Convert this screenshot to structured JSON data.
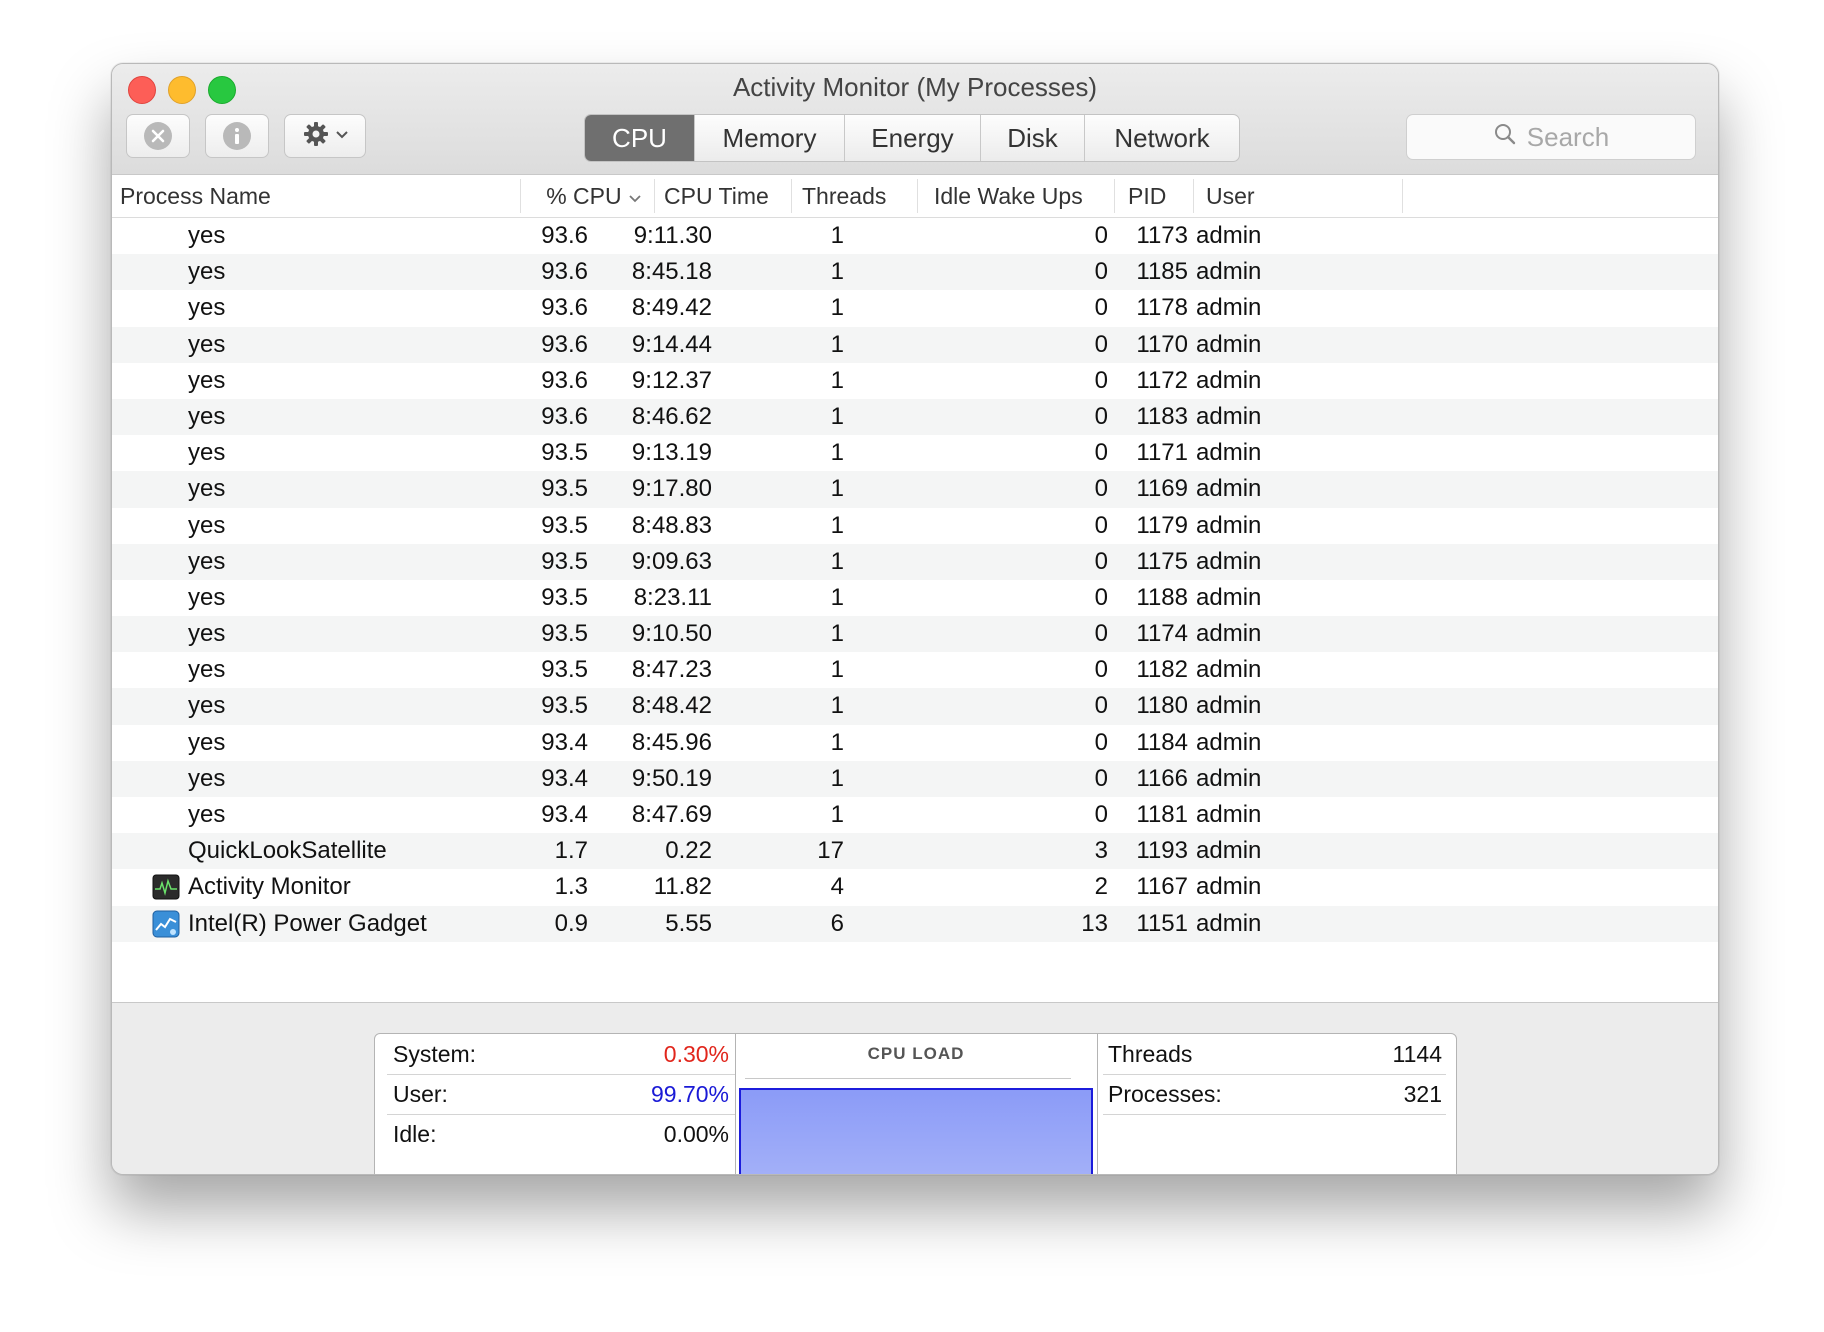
{
  "window": {
    "title": "Activity Monitor (My Processes)"
  },
  "toolbar": {
    "tabs": [
      {
        "label": "CPU",
        "active": true
      },
      {
        "label": "Memory",
        "active": false
      },
      {
        "label": "Energy",
        "active": false
      },
      {
        "label": "Disk",
        "active": false
      },
      {
        "label": "Network",
        "active": false
      }
    ],
    "search_placeholder": "Search"
  },
  "table": {
    "columns": {
      "process_name": "Process Name",
      "cpu_percent": "% CPU",
      "cpu_time": "CPU Time",
      "threads": "Threads",
      "idle_wake_ups": "Idle Wake Ups",
      "pid": "PID",
      "user": "User"
    },
    "sort_column": "cpu_percent",
    "rows": [
      {
        "name": "yes",
        "cpu": "93.6",
        "time": "9:11.30",
        "threads": "1",
        "idle": "0",
        "pid": "1173",
        "user": "admin",
        "icon": ""
      },
      {
        "name": "yes",
        "cpu": "93.6",
        "time": "8:45.18",
        "threads": "1",
        "idle": "0",
        "pid": "1185",
        "user": "admin",
        "icon": ""
      },
      {
        "name": "yes",
        "cpu": "93.6",
        "time": "8:49.42",
        "threads": "1",
        "idle": "0",
        "pid": "1178",
        "user": "admin",
        "icon": ""
      },
      {
        "name": "yes",
        "cpu": "93.6",
        "time": "9:14.44",
        "threads": "1",
        "idle": "0",
        "pid": "1170",
        "user": "admin",
        "icon": ""
      },
      {
        "name": "yes",
        "cpu": "93.6",
        "time": "9:12.37",
        "threads": "1",
        "idle": "0",
        "pid": "1172",
        "user": "admin",
        "icon": ""
      },
      {
        "name": "yes",
        "cpu": "93.6",
        "time": "8:46.62",
        "threads": "1",
        "idle": "0",
        "pid": "1183",
        "user": "admin",
        "icon": ""
      },
      {
        "name": "yes",
        "cpu": "93.5",
        "time": "9:13.19",
        "threads": "1",
        "idle": "0",
        "pid": "1171",
        "user": "admin",
        "icon": ""
      },
      {
        "name": "yes",
        "cpu": "93.5",
        "time": "9:17.80",
        "threads": "1",
        "idle": "0",
        "pid": "1169",
        "user": "admin",
        "icon": ""
      },
      {
        "name": "yes",
        "cpu": "93.5",
        "time": "8:48.83",
        "threads": "1",
        "idle": "0",
        "pid": "1179",
        "user": "admin",
        "icon": ""
      },
      {
        "name": "yes",
        "cpu": "93.5",
        "time": "9:09.63",
        "threads": "1",
        "idle": "0",
        "pid": "1175",
        "user": "admin",
        "icon": ""
      },
      {
        "name": "yes",
        "cpu": "93.5",
        "time": "8:23.11",
        "threads": "1",
        "idle": "0",
        "pid": "1188",
        "user": "admin",
        "icon": ""
      },
      {
        "name": "yes",
        "cpu": "93.5",
        "time": "9:10.50",
        "threads": "1",
        "idle": "0",
        "pid": "1174",
        "user": "admin",
        "icon": ""
      },
      {
        "name": "yes",
        "cpu": "93.5",
        "time": "8:47.23",
        "threads": "1",
        "idle": "0",
        "pid": "1182",
        "user": "admin",
        "icon": ""
      },
      {
        "name": "yes",
        "cpu": "93.5",
        "time": "8:48.42",
        "threads": "1",
        "idle": "0",
        "pid": "1180",
        "user": "admin",
        "icon": ""
      },
      {
        "name": "yes",
        "cpu": "93.4",
        "time": "8:45.96",
        "threads": "1",
        "idle": "0",
        "pid": "1184",
        "user": "admin",
        "icon": ""
      },
      {
        "name": "yes",
        "cpu": "93.4",
        "time": "9:50.19",
        "threads": "1",
        "idle": "0",
        "pid": "1166",
        "user": "admin",
        "icon": ""
      },
      {
        "name": "yes",
        "cpu": "93.4",
        "time": "8:47.69",
        "threads": "1",
        "idle": "0",
        "pid": "1181",
        "user": "admin",
        "icon": ""
      },
      {
        "name": "QuickLookSatellite",
        "cpu": "1.7",
        "time": "0.22",
        "threads": "17",
        "idle": "3",
        "pid": "1193",
        "user": "admin",
        "icon": ""
      },
      {
        "name": "Activity Monitor",
        "cpu": "1.3",
        "time": "11.82",
        "threads": "4",
        "idle": "2",
        "pid": "1167",
        "user": "admin",
        "icon": "activity-monitor-icon"
      },
      {
        "name": "Intel(R) Power Gadget",
        "cpu": "0.9",
        "time": "5.55",
        "threads": "6",
        "idle": "13",
        "pid": "1151",
        "user": "admin",
        "icon": "power-gadget-icon"
      }
    ]
  },
  "summary": {
    "system_label": "System:",
    "system_value": "0.30%",
    "system_color": "#e1261c",
    "user_label": "User:",
    "user_value": "99.70%",
    "user_color": "#1a1ad6",
    "idle_label": "Idle:",
    "idle_value": "0.00%",
    "cpu_load_title": "CPU LOAD",
    "cpu_load_user_fraction": 0.997,
    "threads_label": "Threads",
    "threads_value": "1144",
    "processes_label": "Processes:",
    "processes_value": "321"
  }
}
